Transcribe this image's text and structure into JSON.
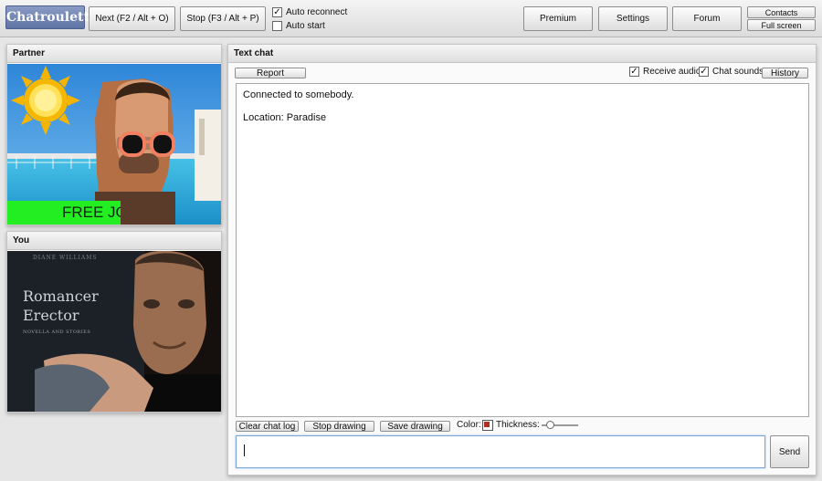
{
  "app": {
    "logo": "Chatroulette"
  },
  "toolbar": {
    "next_label": "Next (F2 / Alt + O)",
    "stop_label": "Stop (F3 / Alt + P)",
    "auto_reconnect_label": "Auto reconnect",
    "auto_reconnect_checked": true,
    "auto_start_label": "Auto start",
    "auto_start_checked": false,
    "premium_label": "Premium",
    "settings_label": "Settings",
    "forum_label": "Forum",
    "contacts_label": "Contacts",
    "fullscreen_label": "Full screen"
  },
  "partner": {
    "title": "Partner",
    "banner_text": "FREE JO",
    "banner_color": "#22ee22"
  },
  "you": {
    "title": "You",
    "book_author": "DIANE WILLIAMS",
    "book_title_line1": "Romancer",
    "book_title_line2": "Erector",
    "book_subtitle": "NOVELLA AND STORIES"
  },
  "chat": {
    "title": "Text chat",
    "report_label": "Report",
    "receive_audio_label": "Receive audio",
    "receive_audio_checked": true,
    "chat_sounds_label": "Chat sounds",
    "chat_sounds_checked": true,
    "history_label": "History",
    "messages": [
      "Connected to somebody.",
      "Location: Paradise"
    ],
    "clear_label": "Clear chat log",
    "stop_drawing_label": "Stop drawing",
    "save_drawing_label": "Save drawing",
    "color_label": "Color:",
    "draw_color": "#b03020",
    "thickness_label": "Thickness:",
    "thickness_value": 0.12,
    "send_label": "Send",
    "message_input_value": ""
  }
}
